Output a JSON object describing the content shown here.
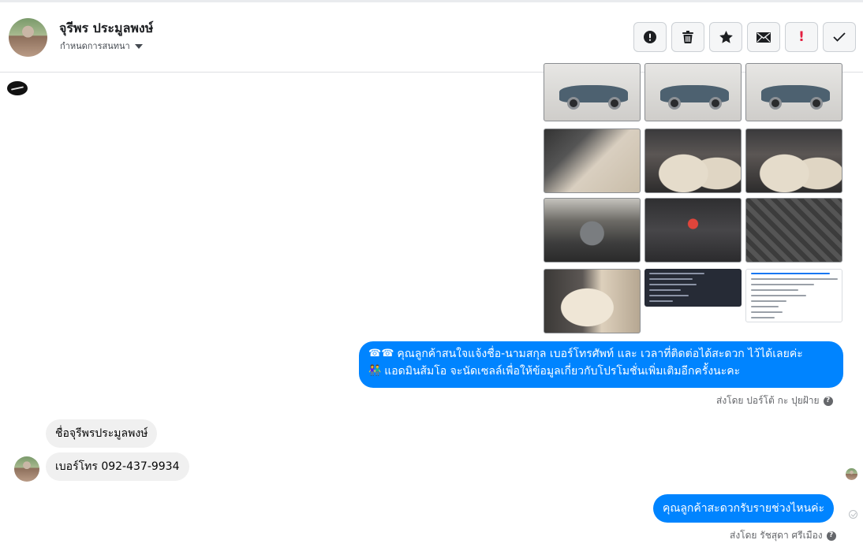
{
  "header": {
    "contact_name": "จุรีพร ประมูลพงษ์",
    "assign_label": "กำหนดการสนทนา",
    "actions": [
      {
        "name": "spam-button",
        "icon": "alert-circle-icon"
      },
      {
        "name": "delete-button",
        "icon": "trash-icon"
      },
      {
        "name": "star-button",
        "icon": "star-icon"
      },
      {
        "name": "mark-unread-button",
        "icon": "envelope-icon"
      },
      {
        "name": "follow-up-button",
        "icon": "exclamation-icon",
        "text": "!"
      },
      {
        "name": "done-button",
        "icon": "check-icon"
      }
    ]
  },
  "chat": {
    "messages": [
      {
        "from": "page",
        "text_line1": "คุณลูกค้าสนใจแจ้งชื่อ-นามสกุล เบอร์โทรศัพท์ และ เวลาที่ติดต่อได้สะดวก ไว้ได้เลยค่ะ",
        "text_line2": "แอดมินส้มโอ จะนัดเซลล์เพื่อให้ข้อมูลเกี่ยวกับโปรโมชั่นเพิ่มเติมอีกครั้งนะคะ",
        "sender": "ส่งโดย ปอร์โต้ กะ ปุยฝ้าย"
      },
      {
        "from": "customer",
        "text": "ชื่อจุรีพรประมูลพงษ์"
      },
      {
        "from": "customer",
        "text": "เบอร์โทร 092-437-9934"
      },
      {
        "from": "page",
        "text": "คุณลูกค้าสะดวกรับรายช่วงไหนค่ะ",
        "sender": "ส่งโดย รัชสุดา ศรีเมือง"
      }
    ],
    "help_icon": "?"
  },
  "colors": {
    "outgoing_bubble": "#0084ff",
    "incoming_bubble": "#f0f0f0",
    "follow_up_red": "#e41e3f"
  }
}
